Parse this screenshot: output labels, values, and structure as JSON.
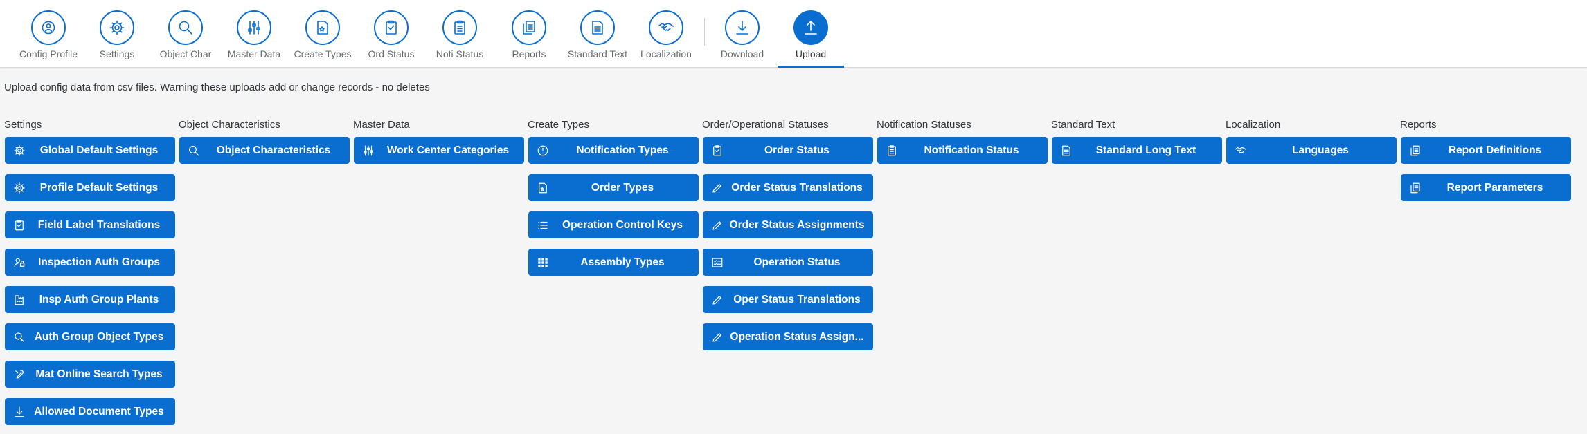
{
  "tabs": [
    {
      "label": "Config Profile",
      "icon": "config-profile-icon"
    },
    {
      "label": "Settings",
      "icon": "gear-icon"
    },
    {
      "label": "Object Char",
      "icon": "search-icon"
    },
    {
      "label": "Master Data",
      "icon": "sliders-icon"
    },
    {
      "label": "Create Types",
      "icon": "document-star-icon"
    },
    {
      "label": "Ord Status",
      "icon": "clipboard-icon"
    },
    {
      "label": "Noti Status",
      "icon": "clipboard-list-icon"
    },
    {
      "label": "Reports",
      "icon": "documents-icon"
    },
    {
      "label": "Standard Text",
      "icon": "document-text-icon"
    },
    {
      "label": "Localization",
      "icon": "handshake-icon"
    },
    {
      "label": "Download",
      "icon": "download-icon"
    },
    {
      "label": "Upload",
      "icon": "upload-icon"
    }
  ],
  "active_tab": "Upload",
  "description": "Upload config data from csv files. Warning these uploads add or change records - no deletes",
  "columns": [
    {
      "title": "Settings",
      "buttons": [
        {
          "label": "Global Default Settings",
          "icon": "gear-icon"
        },
        {
          "label": "Profile Default Settings",
          "icon": "gear-icon"
        },
        {
          "label": "Field Label Translations",
          "icon": "clipboard-icon"
        },
        {
          "label": "Inspection Auth Groups",
          "icon": "user-lock-icon"
        },
        {
          "label": "Insp Auth Group Plants",
          "icon": "factory-icon"
        },
        {
          "label": "Auth Group Object Types",
          "icon": "search-key-icon"
        },
        {
          "label": "Mat Online Search Types",
          "icon": "wrench-icon"
        },
        {
          "label": "Allowed Document Types",
          "icon": "download-icon"
        }
      ]
    },
    {
      "title": "Object Characteristics",
      "buttons": [
        {
          "label": "Object Characteristics",
          "icon": "search-icon"
        }
      ]
    },
    {
      "title": "Master Data",
      "buttons": [
        {
          "label": "Work Center Categories",
          "icon": "sliders-icon"
        }
      ]
    },
    {
      "title": "Create Types",
      "buttons": [
        {
          "label": "Notification Types",
          "icon": "alert-icon"
        },
        {
          "label": "Order Types",
          "icon": "document-star-icon"
        },
        {
          "label": "Operation Control Keys",
          "icon": "list-icon"
        },
        {
          "label": "Assembly Types",
          "icon": "grid-icon"
        }
      ]
    },
    {
      "title": "Order/Operational Statuses",
      "buttons": [
        {
          "label": "Order Status",
          "icon": "clipboard-icon"
        },
        {
          "label": "Order Status Translations",
          "icon": "pencil-icon"
        },
        {
          "label": "Order Status Assignments",
          "icon": "pencil-icon"
        },
        {
          "label": "Operation Status",
          "icon": "checklist-icon"
        },
        {
          "label": "Oper Status Translations",
          "icon": "pencil-icon"
        },
        {
          "label": "Operation Status Assign...",
          "icon": "pencil-icon"
        }
      ]
    },
    {
      "title": "Notification Statuses",
      "buttons": [
        {
          "label": "Notification Status",
          "icon": "clipboard-list-icon"
        }
      ]
    },
    {
      "title": "Standard Text",
      "buttons": [
        {
          "label": "Standard Long Text",
          "icon": "document-text-icon"
        }
      ]
    },
    {
      "title": "Localization",
      "buttons": [
        {
          "label": "Languages",
          "icon": "handshake-icon"
        }
      ]
    },
    {
      "title": "Reports",
      "buttons": [
        {
          "label": "Report Definitions",
          "icon": "documents-icon"
        },
        {
          "label": "Report Parameters",
          "icon": "documents-icon"
        }
      ]
    }
  ]
}
